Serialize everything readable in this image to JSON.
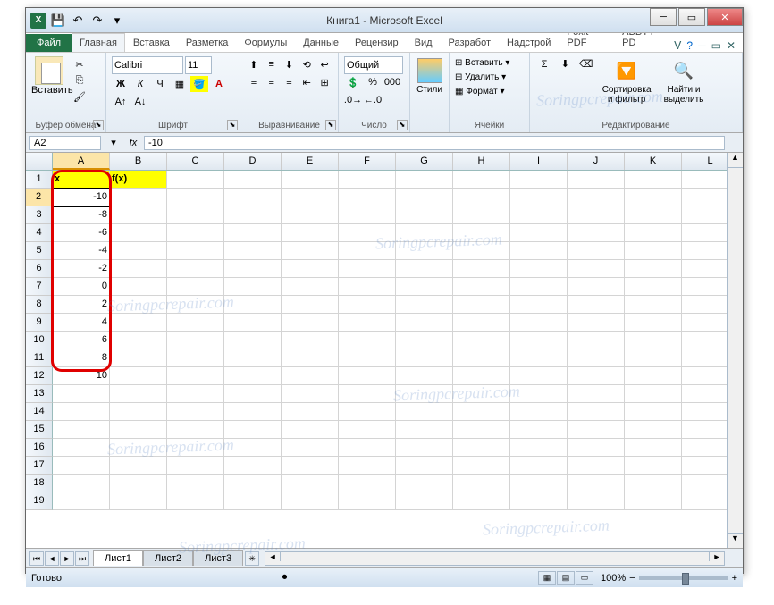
{
  "title": "Книга1 - Microsoft Excel",
  "qat": {
    "save": "💾",
    "undo": "↶",
    "redo": "↷"
  },
  "tabs": {
    "file": "Файл",
    "items": [
      "Главная",
      "Вставка",
      "Разметка",
      "Формулы",
      "Данные",
      "Рецензир",
      "Вид",
      "Разработ",
      "Надстрой",
      "Foxit PDF",
      "ABBYY PD"
    ],
    "active": 0
  },
  "ribbon": {
    "clipboard": {
      "paste": "Вставить",
      "label": "Буфер обмена"
    },
    "font": {
      "name": "Calibri",
      "size": "11",
      "label": "Шрифт"
    },
    "alignment": {
      "label": "Выравнивание"
    },
    "number": {
      "format": "Общий",
      "label": "Число"
    },
    "styles": {
      "btn": "Стили"
    },
    "cells": {
      "insert": "Вставить",
      "delete": "Удалить",
      "format": "Формат",
      "label": "Ячейки"
    },
    "editing": {
      "sort": "Сортировка\nи фильтр",
      "find": "Найти и\nвыделить",
      "label": "Редактирование"
    }
  },
  "nameBox": "A2",
  "formula": "-10",
  "columns": [
    "A",
    "B",
    "C",
    "D",
    "E",
    "F",
    "G",
    "H",
    "I",
    "J",
    "K",
    "L"
  ],
  "rowCount": 19,
  "headerRow": {
    "A": "x",
    "B": "f(x)"
  },
  "dataA": [
    "-10",
    "-8",
    "-6",
    "-4",
    "-2",
    "0",
    "2",
    "4",
    "6",
    "8",
    "10"
  ],
  "activeCell": "A2",
  "sheets": [
    "Лист1",
    "Лист2",
    "Лист3"
  ],
  "activeSheet": 0,
  "status": "Готово",
  "zoom": "100%",
  "watermark": "Soringpcrepair.com"
}
